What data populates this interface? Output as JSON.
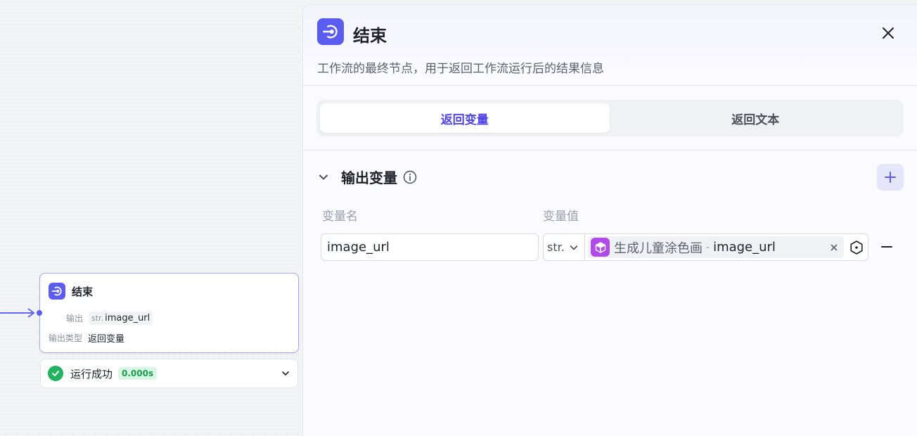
{
  "canvas": {
    "node": {
      "title": "结束",
      "output_label": "输出",
      "output_type": "str.",
      "output_var": "image_url",
      "output_kind_label": "输出类型",
      "output_kind_value": "返回变量"
    },
    "run_status": {
      "text": "运行成功",
      "time": "0.000s"
    }
  },
  "panel": {
    "title": "结束",
    "description": "工作流的最终节点，用于返回工作流运行后的结果信息",
    "tabs": [
      {
        "label": "返回变量",
        "active": true
      },
      {
        "label": "返回文本",
        "active": false
      }
    ],
    "section": {
      "title": "输出变量",
      "col_name": "变量名",
      "col_value": "变量值",
      "rows": [
        {
          "name": "image_url",
          "type": "str.",
          "ref_node": "生成儿童涂色画",
          "ref_sep": "-",
          "ref_var": "image_url"
        }
      ]
    }
  },
  "colors": {
    "accent": "#5a5df0",
    "success": "#22b35e",
    "ref_icon": "#b04be8"
  },
  "icons": {
    "node": "end-node-icon",
    "close": "close-icon",
    "chevron": "chevron-down-icon",
    "info": "info-icon",
    "add": "plus-icon",
    "remove": "minus-icon",
    "check": "check-icon",
    "ref": "cube-icon",
    "picker": "variable-picker-icon"
  }
}
